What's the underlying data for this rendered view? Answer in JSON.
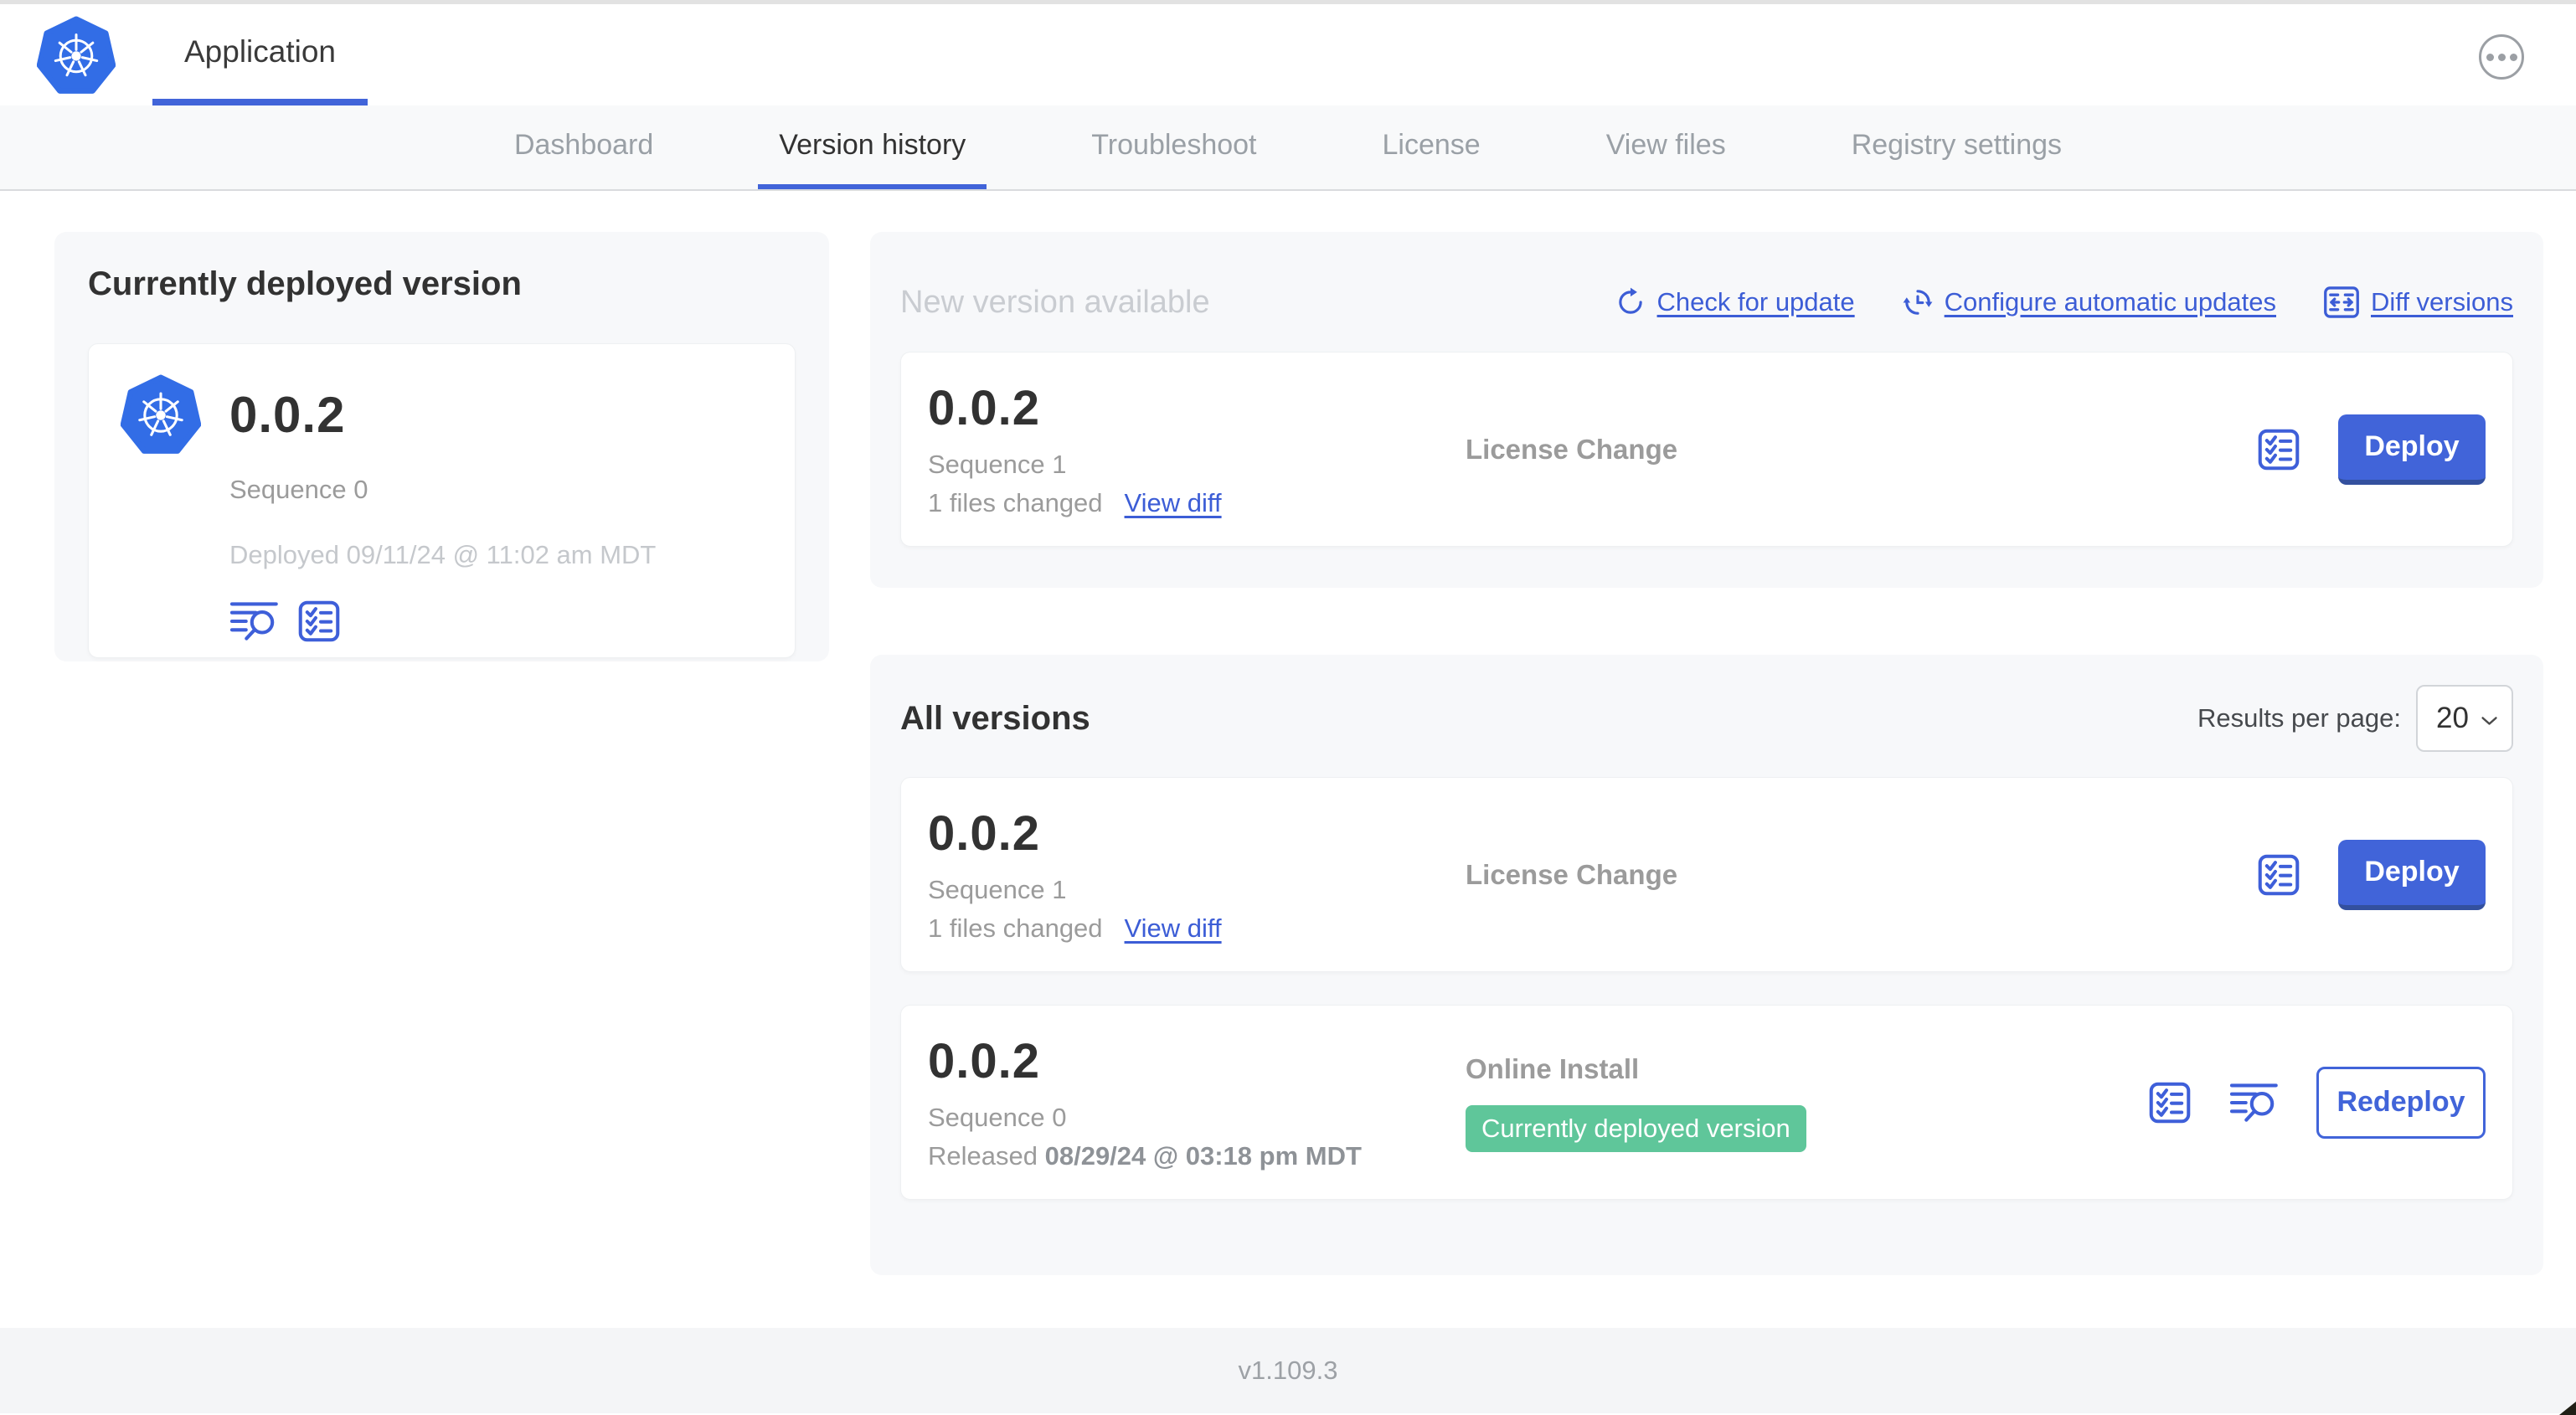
{
  "colors": {
    "accent_blue": "#4164d9",
    "kubernetes_blue": "#326de6",
    "badge_green": "#5fc69a",
    "muted_text": "#9b9b9b"
  },
  "header": {
    "title": "Application",
    "logo_icon": "kubernetes-logo",
    "overflow_menu_icon": "ellipsis"
  },
  "nav": {
    "tabs": [
      "Dashboard",
      "Version history",
      "Troubleshoot",
      "License",
      "View files",
      "Registry settings"
    ],
    "active_tab": "Version history"
  },
  "currently_deployed": {
    "title": "Currently deployed version",
    "version": "0.0.2",
    "sequence": "Sequence 0",
    "deployed_at": "Deployed 09/11/24 @ 11:02 am MDT",
    "icons": [
      "view-logs",
      "preflight-checks"
    ]
  },
  "new_version": {
    "title": "New version available",
    "check_for_update": "Check for update",
    "configure_automatic_updates": "Configure automatic updates",
    "diff_versions": "Diff versions",
    "card": {
      "version": "0.0.2",
      "sequence": "Sequence 1",
      "files_changed": "1 files changed",
      "view_diff": "View diff",
      "source": "License Change",
      "deploy_button": "Deploy"
    }
  },
  "all_versions": {
    "title": "All versions",
    "results_per_page_label": "Results per page:",
    "results_per_page": "20",
    "rows": [
      {
        "version": "0.0.2",
        "sequence": "Sequence 1",
        "files_changed": "1 files changed",
        "view_diff": "View diff",
        "source": "License Change",
        "deploy_button": "Deploy"
      },
      {
        "version": "0.0.2",
        "sequence": "Sequence 0",
        "released_prefix": "Released",
        "released_date": "08/29/24 @ 03:18 pm MDT",
        "source": "Online Install",
        "badge": "Currently deployed version",
        "redeploy_button": "Redeploy"
      }
    ]
  },
  "footer": {
    "version": "v1.109.3"
  }
}
